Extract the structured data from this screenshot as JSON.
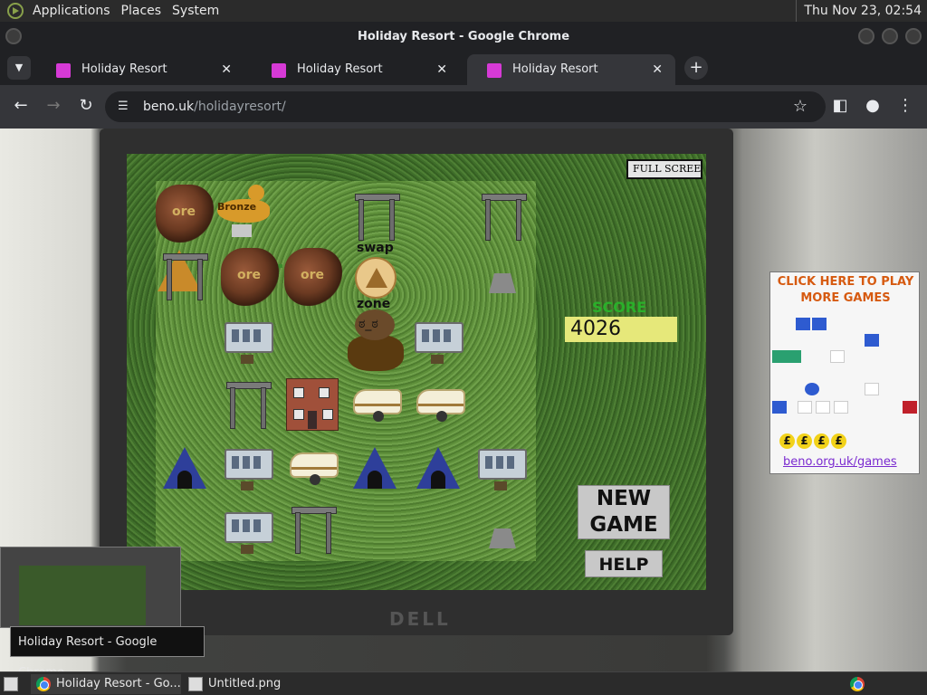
{
  "panel": {
    "menus": [
      "Applications",
      "Places",
      "System"
    ],
    "clock": "Thu Nov 23, 02:54"
  },
  "window": {
    "title": "Holiday Resort - Google Chrome"
  },
  "tabs": [
    {
      "label": "Holiday Resort",
      "active": false
    },
    {
      "label": "Holiday Resort",
      "active": false
    },
    {
      "label": "Holiday Resort",
      "active": true
    }
  ],
  "address": {
    "domain": "beno.uk",
    "path": "/holidayresort/"
  },
  "game": {
    "fullscreen_label": "FULL SCREEN",
    "ore_label": "ore",
    "bronze_label": "Bronze",
    "swap_label": "swap",
    "zone_label": "zone",
    "score_label": "SCORE",
    "score_value": "4026",
    "new_game_label": "NEW GAME",
    "help_label": "HELP"
  },
  "ad": {
    "cta": "CLICK HERE TO PLAY MORE GAMES",
    "coin_symbol": "£",
    "link": "beno.org.uk/games"
  },
  "tooltip": "Holiday Resort - Google Chrome",
  "taskbar": {
    "items": [
      {
        "label": "Holiday Resort - Go...",
        "active": true
      },
      {
        "label": "Untitled.png",
        "active": false
      }
    ]
  }
}
